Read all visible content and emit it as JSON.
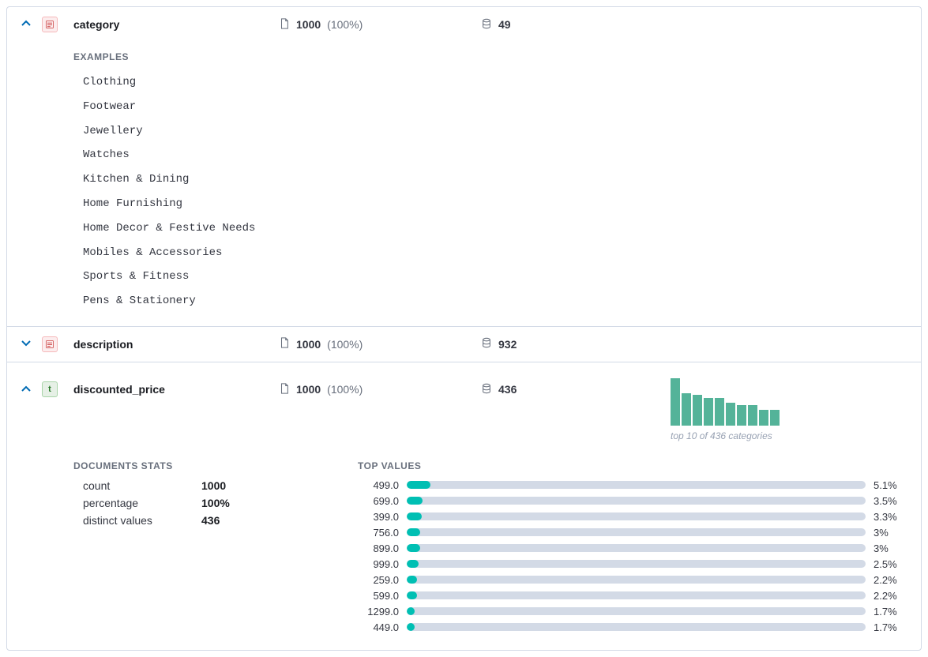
{
  "fields": {
    "category": {
      "name": "category",
      "type_icon": "text",
      "doc_count": "1000",
      "doc_pct": "(100%)",
      "distinct": "49",
      "expanded": true,
      "examples_header": "EXAMPLES",
      "examples": [
        "Clothing",
        "Footwear",
        "Jewellery",
        "Watches",
        "Kitchen & Dining",
        "Home Furnishing",
        "Home Decor & Festive Needs",
        "Mobiles & Accessories",
        "Sports & Fitness",
        "Pens & Stationery"
      ]
    },
    "description": {
      "name": "description",
      "type_icon": "text",
      "doc_count": "1000",
      "doc_pct": "(100%)",
      "distinct": "932",
      "expanded": false
    },
    "discounted_price": {
      "name": "discounted_price",
      "type_icon": "keyword",
      "doc_count": "1000",
      "doc_pct": "(100%)",
      "distinct": "436",
      "expanded": true,
      "mini_caption": "top 10 of 436 categories",
      "stats_header": "DOCUMENTS STATS",
      "top_values_header": "TOP VALUES",
      "stats": {
        "count_label": "count",
        "count_value": "1000",
        "percentage_label": "percentage",
        "percentage_value": "100%",
        "distinct_label": "distinct values",
        "distinct_value": "436"
      },
      "top_values": [
        {
          "label": "499.0",
          "pct": 5.1,
          "pct_text": "5.1%"
        },
        {
          "label": "699.0",
          "pct": 3.5,
          "pct_text": "3.5%"
        },
        {
          "label": "399.0",
          "pct": 3.3,
          "pct_text": "3.3%"
        },
        {
          "label": "756.0",
          "pct": 3.0,
          "pct_text": "3%"
        },
        {
          "label": "899.0",
          "pct": 3.0,
          "pct_text": "3%"
        },
        {
          "label": "999.0",
          "pct": 2.5,
          "pct_text": "2.5%"
        },
        {
          "label": "259.0",
          "pct": 2.2,
          "pct_text": "2.2%"
        },
        {
          "label": "599.0",
          "pct": 2.2,
          "pct_text": "2.2%"
        },
        {
          "label": "1299.0",
          "pct": 1.7,
          "pct_text": "1.7%"
        },
        {
          "label": "449.0",
          "pct": 1.7,
          "pct_text": "1.7%"
        }
      ]
    }
  },
  "chart_data": {
    "type": "bar",
    "title": "top 10 of 436 categories",
    "categories": [
      "499.0",
      "699.0",
      "399.0",
      "756.0",
      "899.0",
      "999.0",
      "259.0",
      "599.0",
      "1299.0",
      "449.0"
    ],
    "values": [
      5.1,
      3.5,
      3.3,
      3.0,
      3.0,
      2.5,
      2.2,
      2.2,
      1.7,
      1.7
    ],
    "ylabel": "percent",
    "ylim": [
      0,
      6
    ]
  }
}
